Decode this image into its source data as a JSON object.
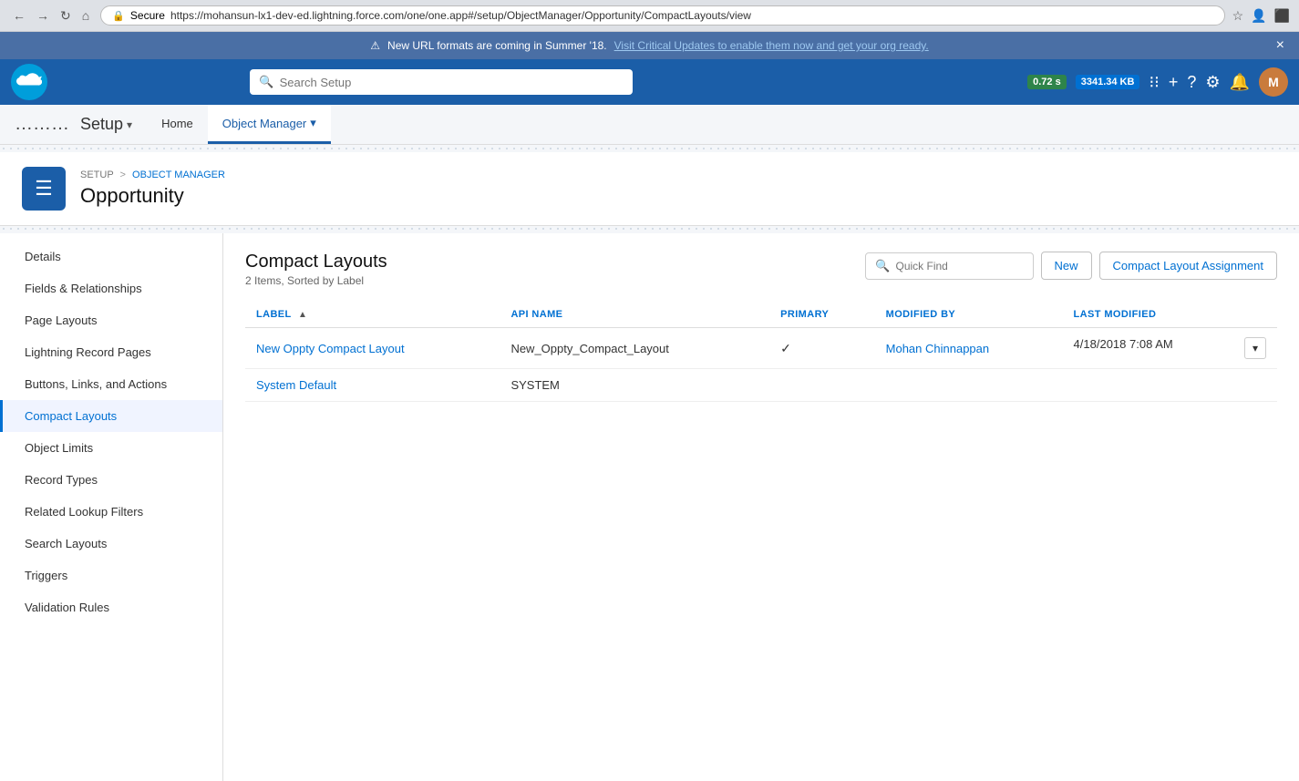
{
  "browser": {
    "url": "https://mohansun-lx1-dev-ed.lightning.force.com/one/one.app#/setup/ObjectManager/Opportunity/CompactLayouts/view",
    "secure_label": "Secure",
    "back_tooltip": "Back",
    "forward_tooltip": "Forward",
    "reload_tooltip": "Reload"
  },
  "banner": {
    "icon": "⚠",
    "text": "New URL formats are coming in Summer '18.",
    "link_text": "Visit Critical Updates to enable them now and get your org ready.",
    "close": "×"
  },
  "topnav": {
    "logo_text": "☁",
    "search_placeholder": "Search Setup",
    "badge_time": "0.72 s",
    "badge_memory": "3341.34 KB",
    "avatar_initials": "M"
  },
  "secondarynav": {
    "app_launcher_icon": "⣿",
    "setup_label": "Setup",
    "dropdown_icon": "▾",
    "tabs": [
      {
        "label": "Home",
        "active": false
      },
      {
        "label": "Object Manager",
        "active": true,
        "dropdown_icon": "▾"
      }
    ]
  },
  "page_header": {
    "icon": "☰",
    "breadcrumb_root": "SETUP",
    "breadcrumb_sep": ">",
    "breadcrumb_link": "OBJECT MANAGER",
    "page_title": "Opportunity"
  },
  "sidebar": {
    "items": [
      {
        "label": "Details",
        "active": false
      },
      {
        "label": "Fields & Relationships",
        "active": false
      },
      {
        "label": "Page Layouts",
        "active": false
      },
      {
        "label": "Lightning Record Pages",
        "active": false
      },
      {
        "label": "Buttons, Links, and Actions",
        "active": false
      },
      {
        "label": "Compact Layouts",
        "active": true
      },
      {
        "label": "Object Limits",
        "active": false
      },
      {
        "label": "Record Types",
        "active": false
      },
      {
        "label": "Related Lookup Filters",
        "active": false
      },
      {
        "label": "Search Layouts",
        "active": false
      },
      {
        "label": "Triggers",
        "active": false
      },
      {
        "label": "Validation Rules",
        "active": false
      }
    ]
  },
  "main": {
    "section_title": "Compact Layouts",
    "section_subtitle": "2 Items, Sorted by Label",
    "quickfind_placeholder": "Quick Find",
    "btn_new": "New",
    "btn_assignment": "Compact Layout Assignment",
    "table": {
      "columns": [
        {
          "label": "LABEL",
          "key": "label",
          "sortable": true,
          "sort_dir": "asc",
          "color": "blue"
        },
        {
          "label": "API NAME",
          "key": "api_name",
          "sortable": false,
          "color": "blue"
        },
        {
          "label": "PRIMARY",
          "key": "primary",
          "sortable": false,
          "color": "blue"
        },
        {
          "label": "MODIFIED BY",
          "key": "modified_by",
          "sortable": false,
          "color": "blue"
        },
        {
          "label": "LAST MODIFIED",
          "key": "last_modified",
          "sortable": false,
          "color": "blue"
        }
      ],
      "rows": [
        {
          "label": "New Oppty Compact Layout",
          "api_name": "New_Oppty_Compact_Layout",
          "primary": true,
          "modified_by": "Mohan Chinnappan",
          "last_modified": "4/18/2018 7:08 AM",
          "has_action": true
        },
        {
          "label": "System Default",
          "api_name": "SYSTEM",
          "primary": false,
          "modified_by": "",
          "last_modified": "",
          "has_action": false
        }
      ]
    }
  }
}
